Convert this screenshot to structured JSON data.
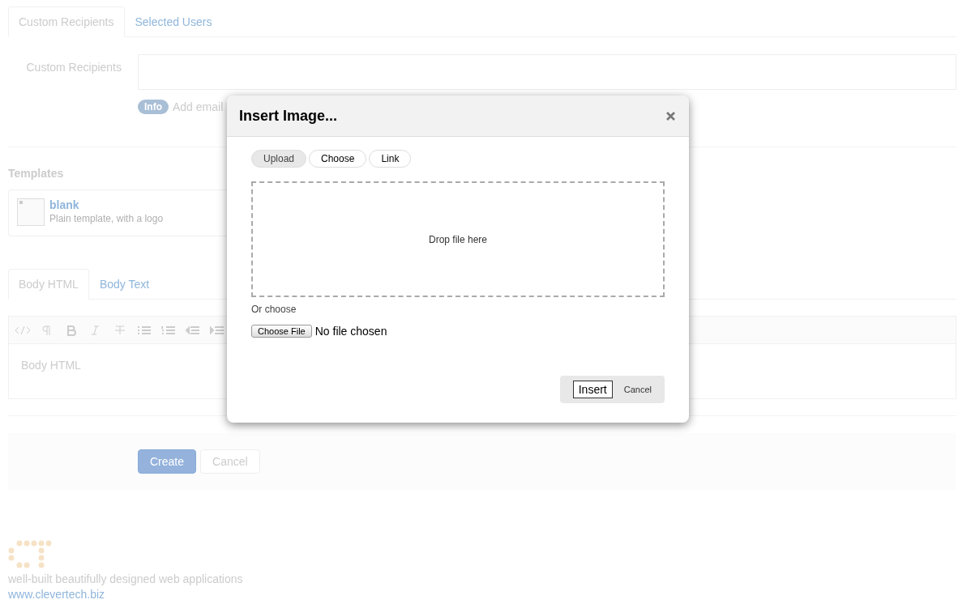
{
  "recipient_tabs": [
    {
      "label": "Custom Recipients",
      "selected": true
    },
    {
      "label": "Selected Users",
      "selected": false
    }
  ],
  "recipients": {
    "label": "Custom Recipients",
    "badge": "Info",
    "help": "Add email"
  },
  "templates": {
    "heading": "Templates",
    "items": [
      {
        "name": "blank",
        "description": "Plain template, with a logo"
      }
    ]
  },
  "body_tabs": [
    {
      "label": "Body HTML",
      "selected": true
    },
    {
      "label": "Body Text",
      "selected": false
    }
  ],
  "editor": {
    "placeholder": "Body HTML"
  },
  "actions": {
    "primary": "Create",
    "secondary": "Cancel"
  },
  "footer": {
    "tagline": "well-built beautifully designed web applications",
    "link": "www.clevertech.biz"
  },
  "dialog": {
    "title": "Insert Image...",
    "tabs": [
      {
        "label": "Upload",
        "selected": true
      },
      {
        "label": "Choose",
        "selected": false
      },
      {
        "label": "Link",
        "selected": false
      }
    ],
    "dropzone": "Drop file here",
    "or_choose": "Or choose",
    "file_button": "Choose File",
    "file_status": "No file chosen",
    "insert": "Insert",
    "cancel": "Cancel"
  }
}
